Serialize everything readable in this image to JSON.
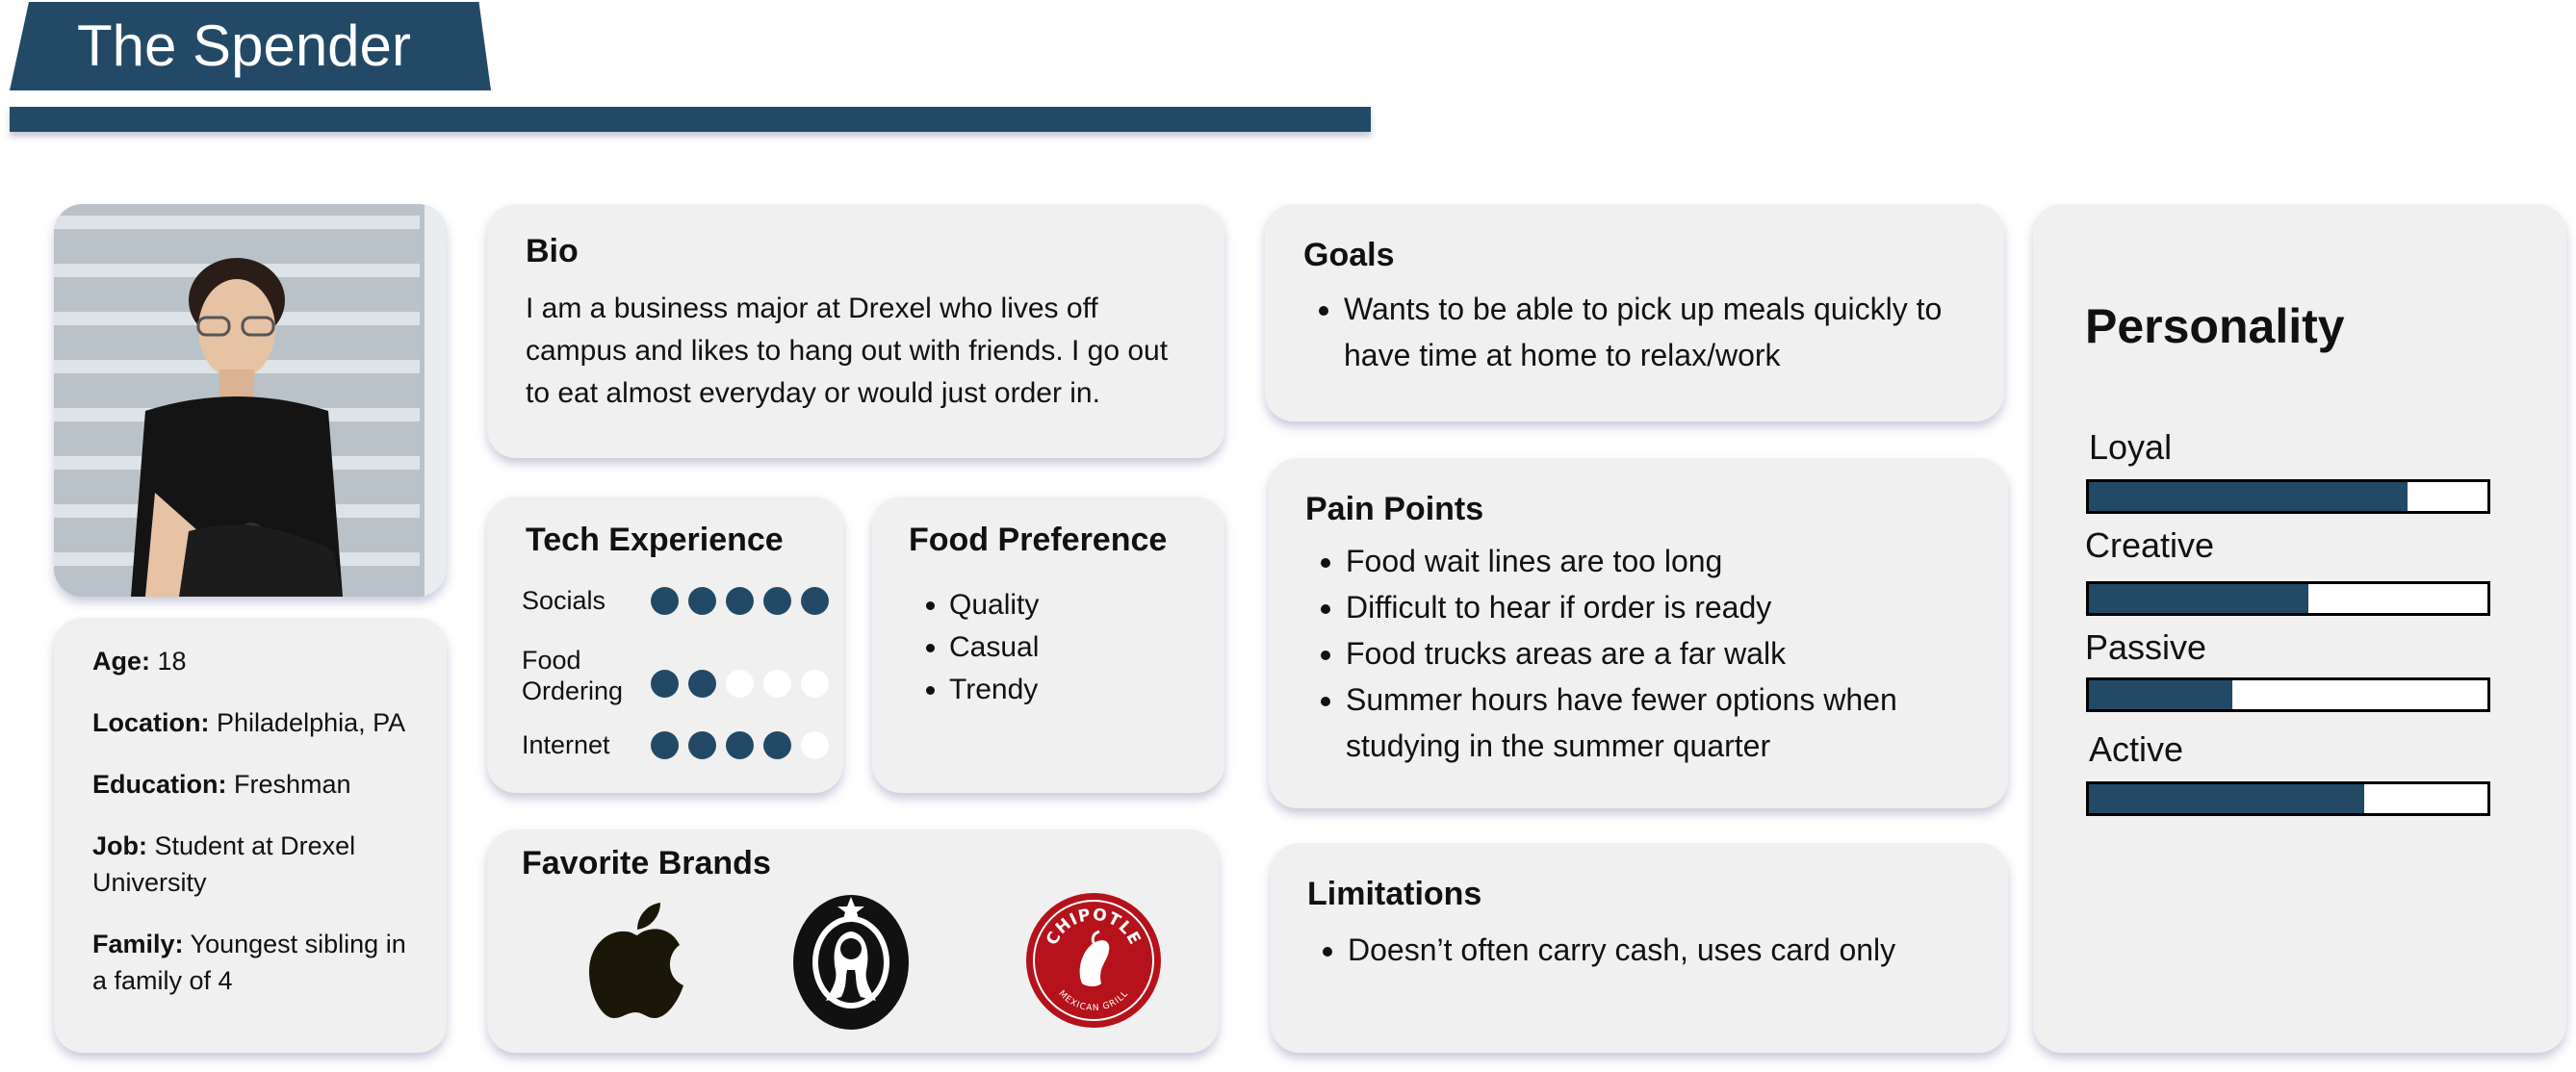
{
  "header": {
    "title": "The Spender"
  },
  "profile": {
    "photo_icon": "person-portrait-icon",
    "details": [
      {
        "label": "Age:",
        "value": " 18"
      },
      {
        "label": "Location:",
        "value": " Philadelphia, PA"
      },
      {
        "label": "Education:",
        "value": " Freshman"
      },
      {
        "label": "Job:",
        "value": " Student at Drexel University"
      },
      {
        "label": "Family:",
        "value": " Youngest sibling in a family of 4"
      }
    ]
  },
  "bio": {
    "title": "Bio",
    "text": "I am a business major at Drexel who lives off campus and likes to hang out with friends. I go out to eat almost everyday or would just order in."
  },
  "tech_experience": {
    "title": "Tech Experience",
    "rows": [
      {
        "label": "Socials",
        "level": 5,
        "max": 5
      },
      {
        "label": "Food Ordering",
        "level": 2,
        "max": 5
      },
      {
        "label": "Internet",
        "level": 4,
        "max": 5
      }
    ]
  },
  "food_preference": {
    "title": "Food Preference",
    "items": [
      "Quality",
      "Casual",
      "Trendy"
    ]
  },
  "favorite_brands": {
    "title": "Favorite Brands",
    "brands": [
      {
        "name": "Apple",
        "icon": "apple-logo-icon"
      },
      {
        "name": "Starbucks",
        "icon": "starbucks-logo-icon"
      },
      {
        "name": "Chipotle",
        "icon": "chipotle-logo-icon",
        "logo_text": "CHIPOTLE",
        "logo_subtext": "MEXICAN GRILL"
      }
    ]
  },
  "goals": {
    "title": "Goals",
    "items": [
      "Wants to be able to pick up meals quickly to have time at home to relax/work"
    ]
  },
  "pain_points": {
    "title": "Pain Points",
    "items": [
      "Food wait lines are too long",
      "Difficult to hear if order is ready",
      "Food trucks areas are a far walk",
      "Summer hours have fewer options when studying in the summer quarter"
    ]
  },
  "limitations": {
    "title": "Limitations",
    "items": [
      "Doesn’t often carry cash, uses card only"
    ]
  },
  "personality": {
    "title": "Personality",
    "traits": [
      {
        "label": "Loyal",
        "value": 0.8
      },
      {
        "label": "Creative",
        "value": 0.55
      },
      {
        "label": "Passive",
        "value": 0.36
      },
      {
        "label": "Active",
        "value": 0.69
      }
    ]
  },
  "colors": {
    "accent": "#224a66",
    "card_bg": "#f0f0f0",
    "chipotle_red": "#b5121b",
    "starbucks_black": "#111111",
    "apple_black": "#1a1608"
  }
}
